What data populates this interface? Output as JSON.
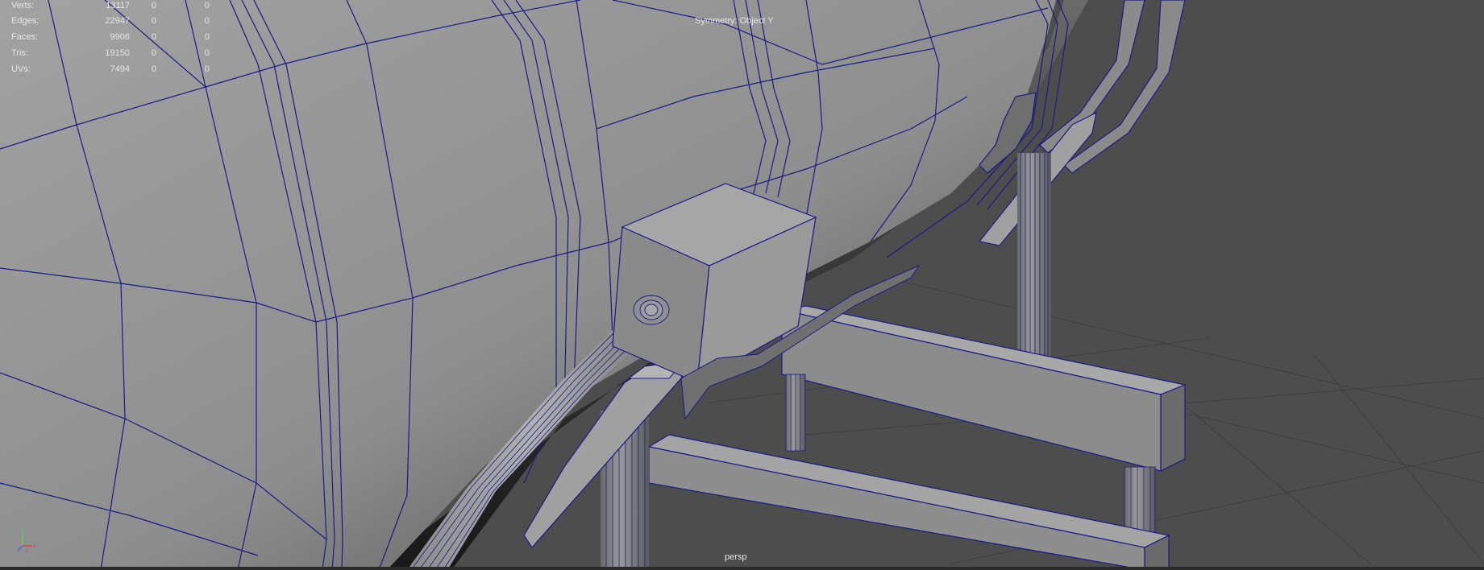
{
  "hud": {
    "rows": [
      {
        "label": "Verts:",
        "total": "13117",
        "selected": "0",
        "component": "0"
      },
      {
        "label": "Edges:",
        "total": "22947",
        "selected": "0",
        "component": "0"
      },
      {
        "label": "Faces:",
        "total": "9906",
        "selected": "0",
        "component": "0"
      },
      {
        "label": "Tris:",
        "total": "19150",
        "selected": "0",
        "component": "0"
      },
      {
        "label": "UVs:",
        "total": "7494",
        "selected": "0",
        "component": "0"
      }
    ]
  },
  "symmetry": "Symmetry: Object Y",
  "camera_name": "persp",
  "axis_labels": {
    "x": "x",
    "y": "y",
    "z": "z"
  },
  "colors": {
    "background": "#4d4d4d",
    "mesh_light": "#9d9d9d",
    "mesh_dark": "#2b2b2b",
    "wireframe": "#1a1a8a",
    "hud_text": "#e6e6e6"
  }
}
